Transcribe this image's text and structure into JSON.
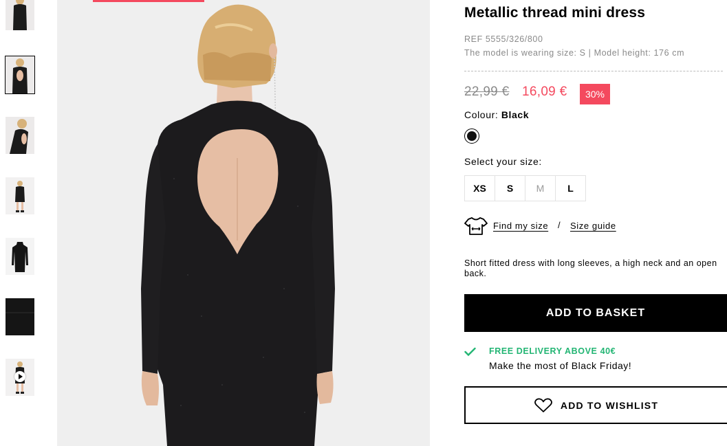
{
  "thumbnails": [
    {
      "name": "thumb-1-front",
      "active": false
    },
    {
      "name": "thumb-2-back",
      "active": true
    },
    {
      "name": "thumb-3-side",
      "active": false
    },
    {
      "name": "thumb-4-full",
      "active": false
    },
    {
      "name": "thumb-5-flat",
      "active": false
    },
    {
      "name": "thumb-6-fabric",
      "active": false
    },
    {
      "name": "thumb-7-video",
      "active": false
    }
  ],
  "product": {
    "title": "Metallic thread mini dress",
    "ref": "REF 5555/326/800",
    "model_info": "The model is wearing size: S | Model height: 176 cm",
    "old_price": "22,99 €",
    "new_price": "16,09 €",
    "discount": "30%",
    "colour_label": "Colour: ",
    "colour_value": "Black",
    "swatch_color": "#111111",
    "size_label": "Select your size:",
    "sizes": [
      {
        "label": "XS",
        "available": true
      },
      {
        "label": "S",
        "available": true
      },
      {
        "label": "M",
        "available": false
      },
      {
        "label": "L",
        "available": true
      }
    ],
    "find_my_size": "Find my size",
    "separator": "/",
    "size_guide": "Size guide",
    "description": "Short fitted dress with long sleeves, a high neck and an open back.",
    "add_to_basket": "ADD TO BASKET",
    "free_delivery": "FREE DELIVERY ABOVE 40€",
    "black_friday": "Make the most of Black Friday!",
    "add_to_wishlist": "ADD TO WISHLIST"
  },
  "colors": {
    "accent": "#f4495e",
    "delivery_green": "#22b573",
    "image_bg": "#efefef"
  },
  "icons": {
    "tshirt": "tshirt-size-icon",
    "check": "check-icon",
    "heart": "heart-icon",
    "play": "play-icon"
  }
}
